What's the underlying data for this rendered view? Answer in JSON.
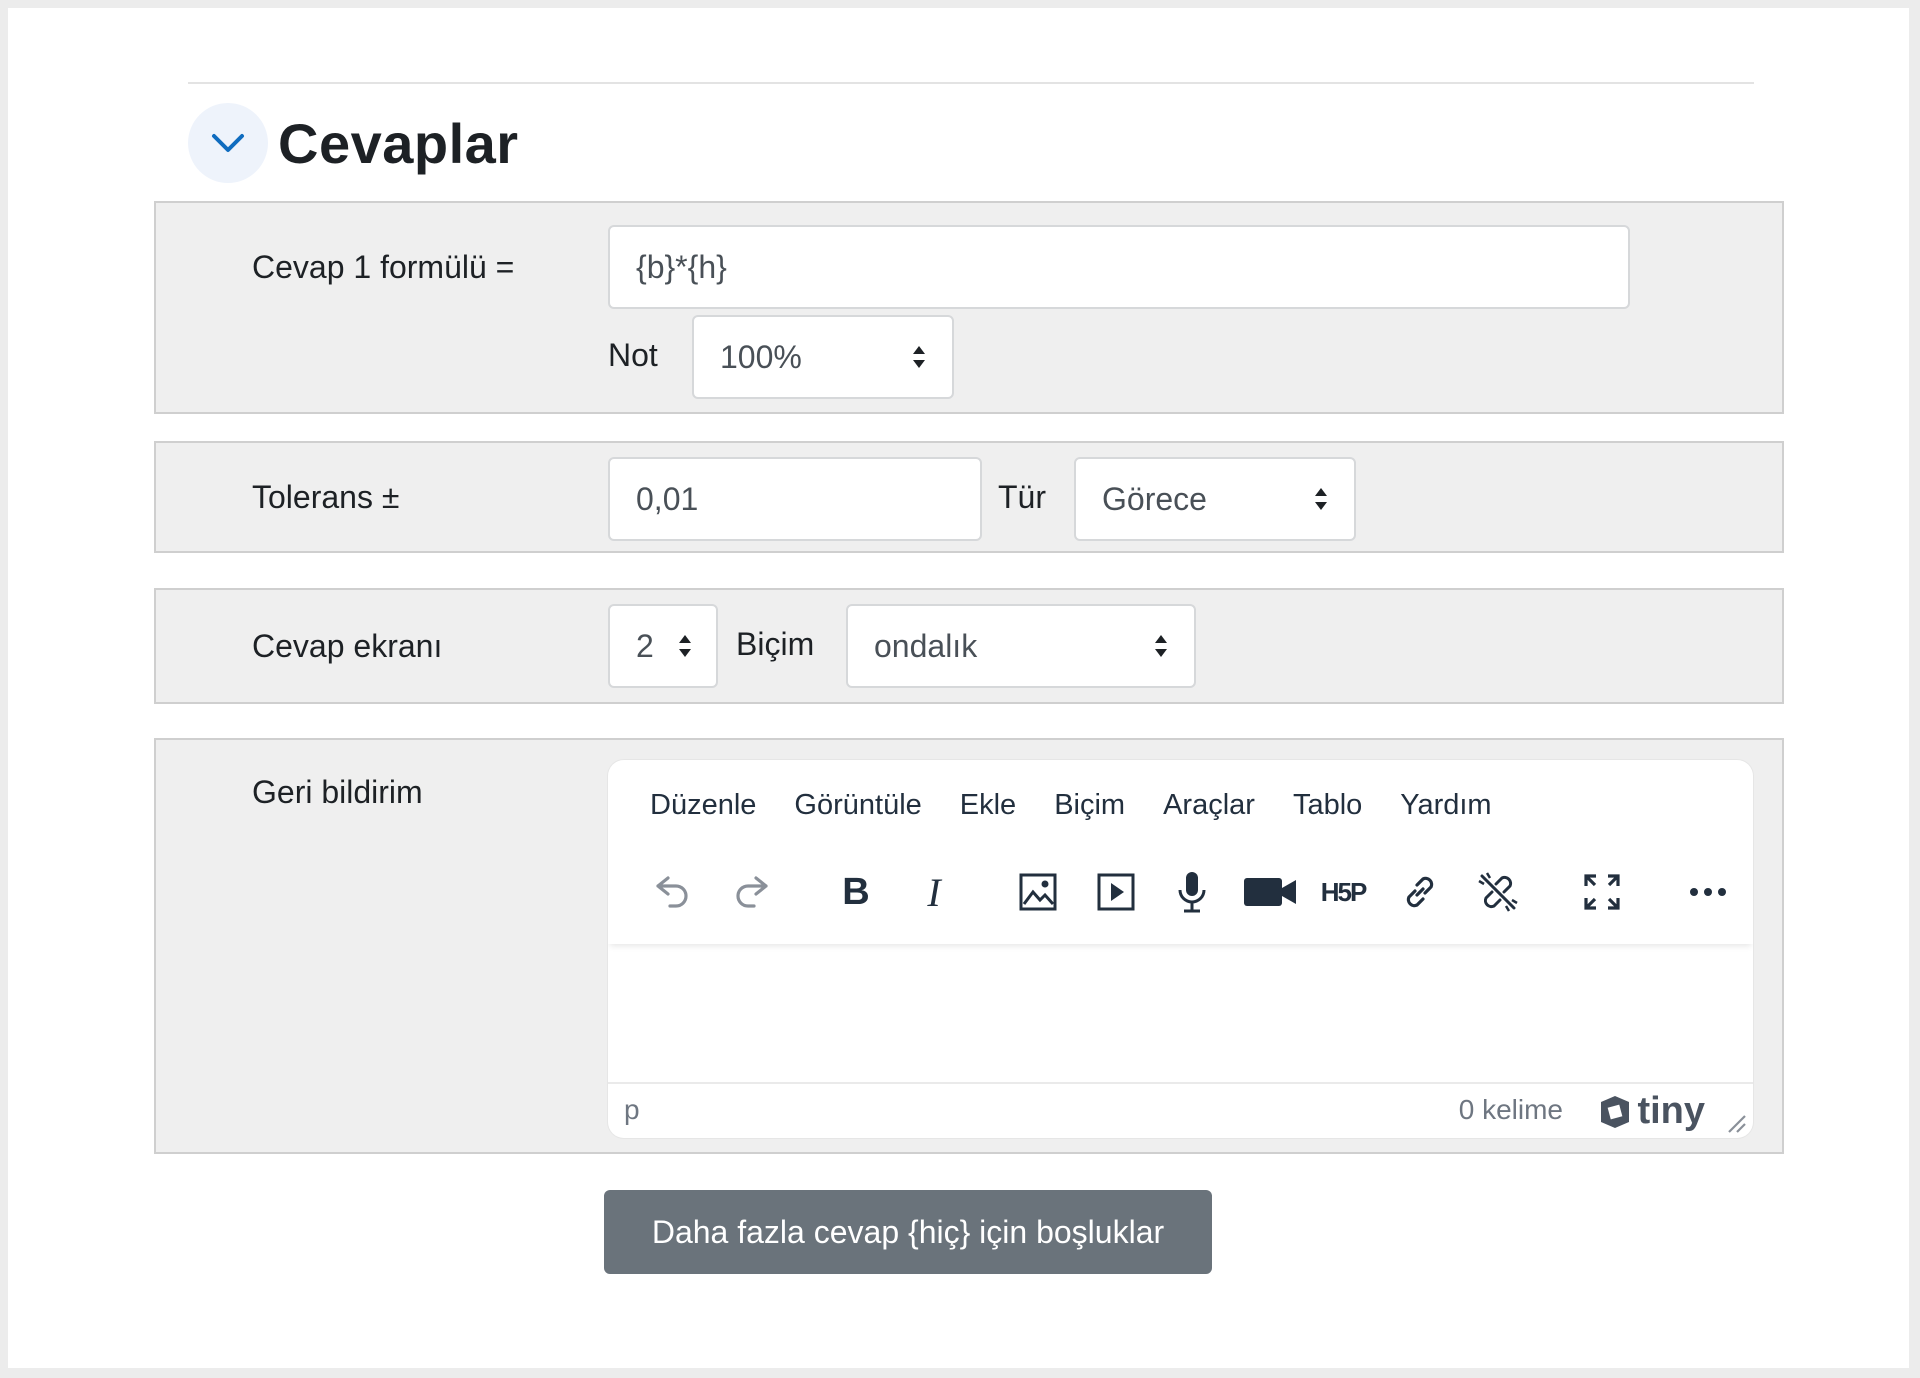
{
  "section": {
    "title": "Cevaplar",
    "toggle_icon": "chevron-down-icon",
    "accent_color": "#0f6cbf"
  },
  "answer": {
    "formula_label": "Cevap 1 formülü =",
    "formula_value": "{b}*{h}",
    "grade_label": "Not",
    "grade_value": "100%"
  },
  "tolerance": {
    "label": "Tolerans ±",
    "value": "0,01",
    "type_label": "Tür",
    "type_value": "Görece"
  },
  "display": {
    "label": "Cevap ekranı",
    "digits_value": "2",
    "format_label": "Biçim",
    "format_value": "ondalık"
  },
  "feedback": {
    "label": "Geri bildirim",
    "menu": [
      "Düzenle",
      "Görüntüle",
      "Ekle",
      "Biçim",
      "Araçlar",
      "Tablo",
      "Yardım"
    ],
    "toolbar_icons": [
      "undo-icon",
      "redo-icon",
      "bold-icon",
      "italic-icon",
      "image-icon",
      "media-icon",
      "microphone-icon",
      "video-camera-icon",
      "h5p-icon",
      "link-icon",
      "unlink-icon",
      "fullscreen-icon",
      "more-icon"
    ],
    "bold_glyph": "B",
    "italic_glyph": "I",
    "h5p_glyph": "H5P",
    "status_path": "p",
    "word_count": "0 kelime",
    "brand": "tiny"
  },
  "more_answers_button": "Daha fazla cevap {hiç} için boşluklar"
}
